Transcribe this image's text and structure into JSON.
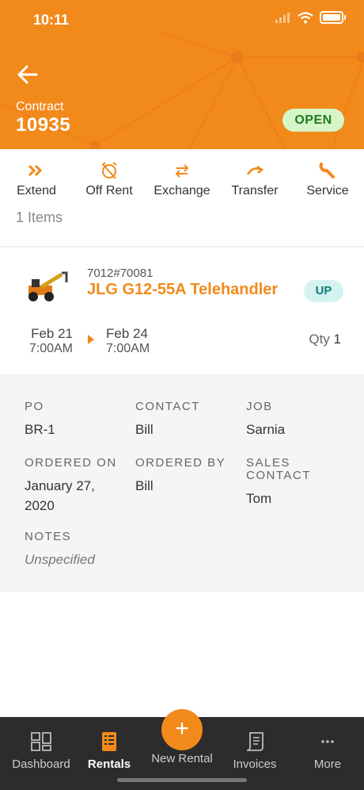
{
  "status_bar": {
    "time": "10:11"
  },
  "header": {
    "contract_label": "Contract",
    "contract_number": "10935",
    "status": "OPEN"
  },
  "actions": [
    {
      "label": "Extend",
      "icon": "extend-icon"
    },
    {
      "label": "Off Rent",
      "icon": "alarm-off-icon"
    },
    {
      "label": "Exchange",
      "icon": "exchange-icon"
    },
    {
      "label": "Transfer",
      "icon": "transfer-icon"
    },
    {
      "label": "Service",
      "icon": "wrench-icon"
    }
  ],
  "items_count": "1 Items",
  "item": {
    "id": "7012#70081",
    "name": "JLG G12-55A Telehandler",
    "badge": "UP",
    "start_day": "Feb 21",
    "start_time": "7:00AM",
    "end_day": "Feb 24",
    "end_time": "7:00AM",
    "qty_label": "Qty",
    "qty_value": "1"
  },
  "details": {
    "po": {
      "label": "PO",
      "value": "BR-1"
    },
    "contact": {
      "label": "CONTACT",
      "value": "Bill"
    },
    "job": {
      "label": "JOB",
      "value": "Sarnia"
    },
    "ordered_on": {
      "label": "ORDERED ON",
      "value": "January 27, 2020"
    },
    "ordered_by": {
      "label": "ORDERED BY",
      "value": "Bill"
    },
    "sales_contact": {
      "label": "SALES CONTACT",
      "value": "Tom"
    },
    "notes": {
      "label": "NOTES",
      "value": "Unspecified"
    }
  },
  "tabs": [
    {
      "label": "Dashboard",
      "icon": "dashboard-icon"
    },
    {
      "label": "Rentals",
      "icon": "rentals-icon",
      "active": true
    },
    {
      "label": "New Rental",
      "icon": "plus-icon"
    },
    {
      "label": "Invoices",
      "icon": "invoice-icon"
    },
    {
      "label": "More",
      "icon": "more-icon"
    }
  ],
  "colors": {
    "brand_orange": "#f28a1b",
    "open_badge_bg": "#d6f5c9",
    "up_badge_bg": "#d4f3f0",
    "tabbar_bg": "#2c2c2c"
  }
}
